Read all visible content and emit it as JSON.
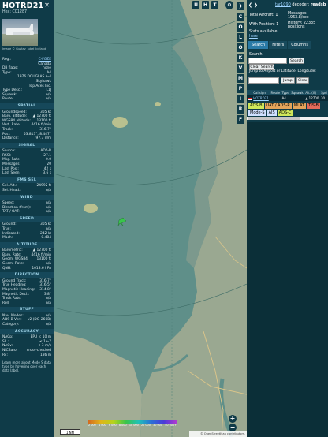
{
  "selected": {
    "callsign": "HOTRD21",
    "hex": "Hex: C01287",
    "photo_credit": "Image © Gustav_Jubel_Iceland",
    "close_glyph": "✕",
    "basic": [
      {
        "k": "Reg.:",
        "v": "C-FGZE",
        "link": true
      },
      {
        "k": "",
        "v": "Canada",
        "link": false
      },
      {
        "k": "DB flags:",
        "v": "none",
        "link": false
      },
      {
        "k": "Type:",
        "v": "A4",
        "link": false
      },
      {
        "k": "",
        "v": "1976 DOUGLAS A-4",
        "link": false
      },
      {
        "k": "",
        "v": "Skyhawk",
        "link": false
      },
      {
        "k": "",
        "v": "Top Aces Inc.",
        "link": false
      },
      {
        "k": "Type Desc.:",
        "v": "L1J",
        "link": false
      },
      {
        "k": "Squawk:",
        "v": "n/a",
        "link": false
      },
      {
        "k": "Route:",
        "v": "n/a",
        "link": false
      }
    ],
    "sections": [
      {
        "title": "SPATIAL",
        "rows": [
          {
            "k": "Groundspeed:",
            "v": "305 kt"
          },
          {
            "k": "Baro. altitude:",
            "v": "▲ 12700 ft"
          },
          {
            "k": "WGS84 altitude:",
            "v": "13100 ft"
          },
          {
            "k": "Vert. Rate:",
            "v": "4416 ft/min"
          },
          {
            "k": "Track:",
            "v": "316.7°"
          },
          {
            "k": "Pos.:",
            "v": "53.813°, 8.447°"
          },
          {
            "k": "Distance:",
            "v": "97.7 nmi"
          }
        ]
      },
      {
        "title": "SIGNAL",
        "rows": [
          {
            "k": "Source:",
            "v": "ADS-B"
          },
          {
            "k": "RSSI:",
            "v": "-27.1"
          },
          {
            "k": "Msg. Rate:",
            "v": "0.0"
          },
          {
            "k": "Messages:",
            "v": "20"
          },
          {
            "k": "Last Pos.:",
            "v": "42 s"
          },
          {
            "k": "Last Seen:",
            "v": "3.6 s"
          }
        ]
      },
      {
        "title": "FMS SEL",
        "rows": [
          {
            "k": "Sel. Alt.:",
            "v": "24992 ft"
          },
          {
            "k": "Sel. Head.:",
            "v": "n/a"
          }
        ]
      },
      {
        "title": "WIND",
        "rows": [
          {
            "k": "Speed:",
            "v": "n/a"
          },
          {
            "k": "Direction (from):",
            "v": "n/a"
          },
          {
            "k": "TAT / OAT:",
            "v": "n/a"
          }
        ]
      },
      {
        "title": "SPEED",
        "rows": [
          {
            "k": "Ground:",
            "v": "305 kt"
          },
          {
            "k": "True:",
            "v": "n/a"
          },
          {
            "k": "Indicated:",
            "v": "242 kt"
          },
          {
            "k": "Mach:",
            "v": "0.484"
          }
        ]
      },
      {
        "title": "ALTITUDE",
        "rows": [
          {
            "k": "Barometric:",
            "v": "▲ 12700 ft"
          },
          {
            "k": "Baro. Rate:",
            "v": "4416 ft/min"
          },
          {
            "k": "Geom. WGS84:",
            "v": "13100 ft"
          },
          {
            "k": "Geom. Rate:",
            "v": "n/a"
          },
          {
            "k": "QNH:",
            "v": "1013.6 hPa"
          }
        ]
      },
      {
        "title": "DIRECTION",
        "rows": [
          {
            "k": "Ground Track:",
            "v": "316.7°"
          },
          {
            "k": "True Heading:",
            "v": "316.5°"
          },
          {
            "k": "Magnetic Heading:",
            "v": "314.8°"
          },
          {
            "k": "Magnetic Decl.:",
            "v": "3.8°"
          },
          {
            "k": "Track Rate:",
            "v": "n/a"
          },
          {
            "k": "Roll:",
            "v": "n/a"
          }
        ]
      },
      {
        "title": "STUFF",
        "rows": [
          {
            "k": "Nav. Modes:",
            "v": "n/a"
          },
          {
            "k": "ADS-B Ver.:",
            "v": "v2 (DO-260B)"
          },
          {
            "k": "Category:",
            "v": "n/a"
          }
        ]
      },
      {
        "title": "ACCURACY",
        "rows": [
          {
            "k": "NACp:",
            "v": "EPU < 10 m"
          },
          {
            "k": "SIL:",
            "v": "≤ 1e-7"
          },
          {
            "k": "NACv:",
            "v": "< 3 m/s"
          },
          {
            "k": "NICBaro:",
            "v": "cross-checked"
          },
          {
            "k": "Rc:",
            "v": "186 m"
          }
        ]
      }
    ],
    "footnote": "Learn more about Mode S data type by hovering over each data label."
  },
  "map": {
    "top_buttons": [
      "U",
      "H",
      "T"
    ],
    "side_buttons": [
      "C",
      "O",
      "L",
      "O",
      "K",
      "V",
      "M",
      "P",
      "I",
      "R",
      "F"
    ],
    "zoom_in": "+",
    "zoom_out": "−",
    "scale_label": "1 NM",
    "alt_ticks": [
      "2 000",
      "4 000",
      "6 000",
      "8 000",
      "10 000",
      "20 000",
      "30 000",
      "40 000+"
    ],
    "osm_credit": "© OpenStreetMap contributors."
  },
  "sidebar": {
    "nav_arrows": "❮ ❯",
    "decoder_prefix": "tar1090",
    "decoder_mid": " decoder: ",
    "decoder_name": "readsb",
    "total_aircraft": "Total Aircraft: 1",
    "messages": "Messages: 1963.8/sec",
    "with_position": "With Position: 1",
    "history": "History: 22335 positions",
    "stats_available": "Stats available",
    "stats_here": "here",
    "tabs": [
      "Search",
      "Filters",
      "Columns"
    ],
    "search_label": "Search:",
    "search_button": "Search",
    "clear_search": "Clear Search",
    "jump_label": "Jump to Airport or Latitude, Longitude:",
    "jump_button": "Jump",
    "clear_button": "Clear",
    "columns": [
      "Callsign",
      "Route",
      "Type",
      "Squawk",
      "Alt. (ft)",
      "Spd"
    ],
    "row": {
      "callsign": "HOTRD21",
      "route": "",
      "type": "A4",
      "squawk": "",
      "alt": "▲ 12700",
      "spd": "30"
    },
    "legend": [
      "ADS-B",
      "UAT / ADS-R",
      "MLAT",
      "TIS-B",
      "Mode-S",
      "AIS",
      "ADS-C"
    ]
  },
  "colors": {
    "panel": "#0f3b48",
    "accent": "#9ed4ff",
    "aircraft": "#39c44c"
  }
}
